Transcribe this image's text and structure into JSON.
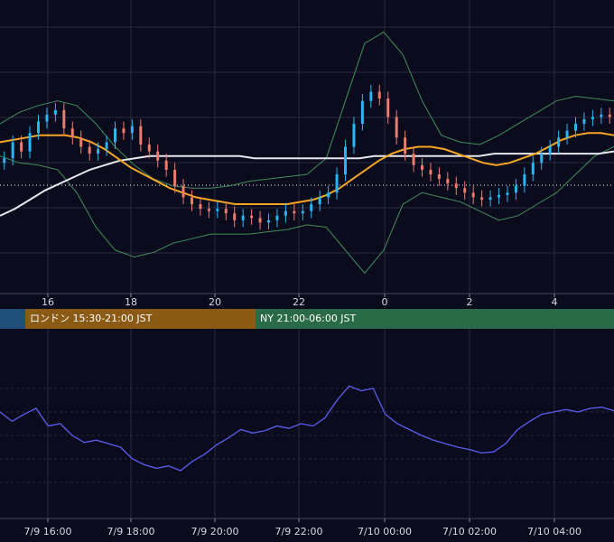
{
  "price_axis": {
    "ticks": [
      "16",
      "18",
      "20",
      "22",
      "0",
      "2",
      "4"
    ]
  },
  "sessions": [
    {
      "label": "",
      "color": "#1f4e79"
    },
    {
      "label": "ロンドン 15:30-21:00 JST",
      "color": "#8b5a14"
    },
    {
      "label": "NY 21:00-06:00 JST",
      "color": "#2a6b47"
    }
  ],
  "rsi_axis": {
    "ticks": [
      "7/9 16:00",
      "7/9 18:00",
      "7/9 20:00",
      "7/9 22:00",
      "7/10 00:00",
      "7/10 02:00",
      "7/10 04:00"
    ]
  },
  "colors": {
    "background": "#0b0b1e",
    "grid": "#2a2a40",
    "bull": "#29b6f6",
    "bear": "#ef7b6b",
    "ma_short": "#f5a623",
    "ma_long": "#e8e8ee",
    "bollinger": "#3f8f5a",
    "rsi_line": "#5a5ef0",
    "axis_text": "#d8d8e0"
  },
  "chart_data": [
    {
      "type": "line",
      "description_kind": "candlestick-overlay",
      "x_ticks": [
        "16",
        "18",
        "20",
        "22",
        "0",
        "2",
        "4"
      ],
      "close": [
        115,
        122,
        118,
        126,
        131,
        134,
        136,
        128,
        124,
        120,
        117,
        119,
        122,
        128,
        126,
        129,
        121,
        118,
        114,
        110,
        103,
        98,
        95,
        93,
        92,
        93,
        91,
        88,
        90,
        89,
        87,
        88,
        90,
        92,
        91,
        92,
        95,
        98,
        100,
        108,
        120,
        130,
        140,
        144,
        141,
        133,
        124,
        117,
        112,
        110,
        108,
        106,
        104,
        102,
        100,
        98,
        97,
        98,
        99,
        100,
        103,
        108,
        113,
        117,
        120,
        124,
        127,
        130,
        132,
        133,
        134,
        133
      ],
      "ma_short": [
        122,
        123,
        124,
        125,
        125,
        125,
        124,
        122,
        119,
        115,
        111,
        108,
        105,
        102,
        100,
        98,
        97,
        96,
        95,
        95,
        95,
        95,
        95,
        96,
        97,
        99,
        102,
        106,
        110,
        114,
        117,
        119,
        120,
        120,
        119,
        117,
        115,
        113,
        112,
        113,
        115,
        117,
        120,
        123,
        125,
        126,
        126,
        125
      ],
      "ma_long": [
        90,
        93,
        97,
        101,
        104,
        107,
        110,
        112,
        114,
        115,
        116,
        116,
        116,
        116,
        116,
        116,
        116,
        115,
        115,
        115,
        115,
        115,
        115,
        115,
        115,
        116,
        116,
        116,
        116,
        116,
        116,
        116,
        116,
        117,
        117,
        117,
        117,
        117,
        117,
        117,
        117,
        118
      ],
      "bb_upper": [
        130,
        135,
        138,
        140,
        138,
        130,
        120,
        112,
        106,
        103,
        102,
        102,
        103,
        105,
        106,
        107,
        108,
        115,
        140,
        165,
        170,
        160,
        140,
        125,
        122,
        121,
        125,
        130,
        135,
        140,
        142,
        141,
        140
      ],
      "bb_lower": [
        116,
        113,
        112,
        110,
        100,
        85,
        75,
        72,
        74,
        78,
        80,
        82,
        82,
        82,
        83,
        84,
        86,
        85,
        75,
        65,
        75,
        95,
        100,
        98,
        96,
        92,
        88,
        90,
        95,
        100,
        108,
        116,
        120
      ]
    },
    {
      "type": "line",
      "description_kind": "oscillator",
      "x_ticks": [
        "7/9 16:00",
        "7/9 18:00",
        "7/9 20:00",
        "7/9 22:00",
        "7/10 00:00",
        "7/10 02:00",
        "7/10 04:00"
      ],
      "values": [
        60,
        52,
        58,
        63,
        48,
        50,
        40,
        34,
        36,
        33,
        30,
        20,
        15,
        12,
        14,
        10,
        18,
        24,
        32,
        38,
        45,
        42,
        44,
        48,
        46,
        50,
        48,
        55,
        70,
        82,
        78,
        80,
        58,
        50,
        45,
        40,
        36,
        33,
        30,
        28,
        25,
        26,
        33,
        45,
        52,
        58,
        60,
        62,
        60,
        63,
        64,
        61
      ]
    }
  ]
}
